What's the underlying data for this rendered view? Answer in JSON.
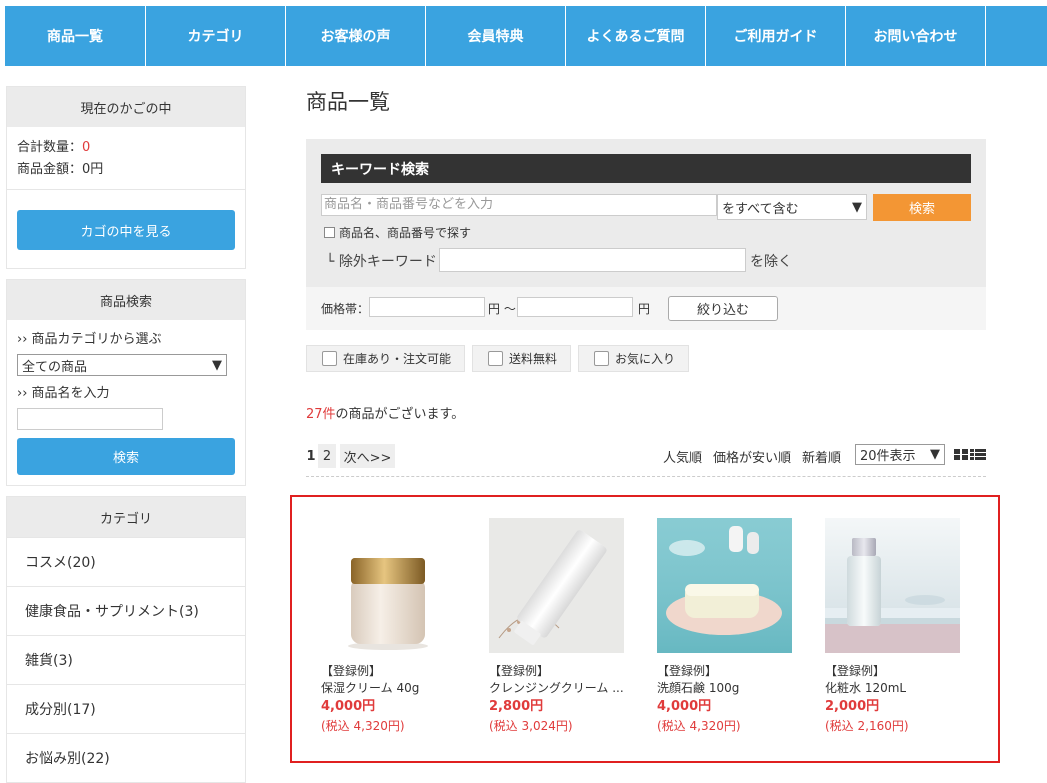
{
  "nav": [
    {
      "label": "商品一覧"
    },
    {
      "label": "カテゴリ"
    },
    {
      "label": "お客様の声"
    },
    {
      "label": "会員特典"
    },
    {
      "label": "よくあるご質問"
    },
    {
      "label": "ご利用ガイド"
    },
    {
      "label": "お問い合わせ"
    }
  ],
  "cart": {
    "title": "現在のかごの中",
    "qty_label": "合計数量：",
    "qty_value": "0",
    "amount_label": "商品金額：0円",
    "button": "カゴの中を見る"
  },
  "side_search": {
    "title": "商品検索",
    "category_label": "›› 商品カテゴリから選ぶ",
    "category_selected": "全ての商品",
    "name_label": "›› 商品名を入力",
    "button": "検索"
  },
  "categories": {
    "title": "カテゴリ",
    "items": [
      {
        "label": "コスメ(20)"
      },
      {
        "label": "健康食品・サプリメント(3)"
      },
      {
        "label": "雑貨(3)"
      },
      {
        "label": "成分別(17)"
      },
      {
        "label": "お悩み別(22)"
      }
    ]
  },
  "main": {
    "title": "商品一覧",
    "keyword": {
      "heading": "キーワード検索",
      "placeholder": "商品名・商品番号などを入力",
      "mode": "をすべて含む",
      "button": "検索",
      "checkbox_label": "商品名、商品番号で探す",
      "exclude_label": "└ 除外キーワード",
      "exclude_suffix": "を除く"
    },
    "price": {
      "label": "価格帯：",
      "mid": "円 ～",
      "end": "円",
      "button": "絞り込む"
    },
    "filters": [
      {
        "label": "在庫あり・注文可能"
      },
      {
        "label": "送料無料"
      },
      {
        "label": "お気に入り"
      }
    ],
    "count_number": "27件",
    "count_text": "の商品がございます。",
    "pager": {
      "current": "1",
      "page2": "2",
      "next": "次へ>>"
    },
    "sorts": [
      {
        "label": "人気順"
      },
      {
        "label": "価格が安い順"
      },
      {
        "label": "新着順"
      }
    ],
    "per_page": "20件表示"
  },
  "products": [
    {
      "tag": "【登録例】",
      "name": "保湿クリーム 40g",
      "price": "4,000円",
      "tax": "(税込 4,320円)",
      "image": "cream-jar"
    },
    {
      "tag": "【登録例】",
      "name": "クレンジングクリーム ...",
      "price": "2,800円",
      "tax": "(税込 3,024円)",
      "image": "cleansing-tube"
    },
    {
      "tag": "【登録例】",
      "name": "洗顔石鹸 100g",
      "price": "4,000円",
      "tax": "(税込 4,320円)",
      "image": "soap-bar"
    },
    {
      "tag": "【登録例】",
      "name": "化粧水 120mL",
      "price": "2,000円",
      "tax": "(税込 2,160円)",
      "image": "toner-bottle"
    }
  ],
  "colors": {
    "nav_blue": "#3aa3e0",
    "accent_orange": "#f39634",
    "price_red": "#e03b3b",
    "highlight_border": "#e02020"
  }
}
